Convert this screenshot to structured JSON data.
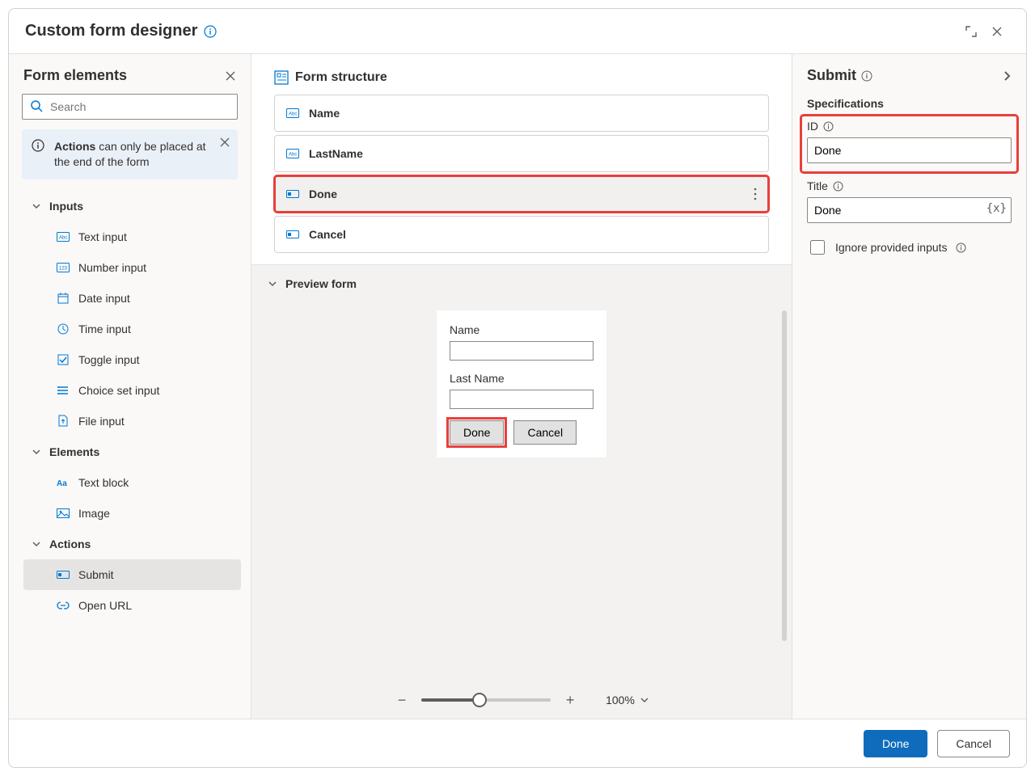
{
  "title": "Custom form designer",
  "sidebar": {
    "heading": "Form elements",
    "search_placeholder": "Search",
    "notice_strong": "Actions",
    "notice_rest": " can only be placed at the end of the form",
    "categories": {
      "inputs": {
        "label": "Inputs"
      },
      "elements": {
        "label": "Elements"
      },
      "actions": {
        "label": "Actions"
      }
    },
    "items": {
      "text_input": "Text input",
      "number_input": "Number input",
      "date_input": "Date input",
      "time_input": "Time input",
      "toggle_input": "Toggle input",
      "choice_set_input": "Choice set input",
      "file_input": "File input",
      "text_block": "Text block",
      "image": "Image",
      "submit": "Submit",
      "open_url": "Open URL"
    }
  },
  "structure": {
    "heading": "Form structure",
    "cards": [
      {
        "id": "name",
        "label": "Name",
        "kind": "text"
      },
      {
        "id": "lastname",
        "label": "LastName",
        "kind": "text"
      },
      {
        "id": "done",
        "label": "Done",
        "kind": "action",
        "selected": true
      },
      {
        "id": "cancel",
        "label": "Cancel",
        "kind": "action"
      }
    ]
  },
  "preview": {
    "heading": "Preview form",
    "field1_label": "Name",
    "field2_label": "Last Name",
    "done_btn": "Done",
    "cancel_btn": "Cancel",
    "zoom_value": "100%"
  },
  "props": {
    "heading": "Submit",
    "section": "Specifications",
    "id_label": "ID",
    "id_value": "Done",
    "title_label": "Title",
    "title_value": "Done",
    "ignore_label": "Ignore provided inputs"
  },
  "footer": {
    "primary": "Done",
    "secondary": "Cancel"
  }
}
